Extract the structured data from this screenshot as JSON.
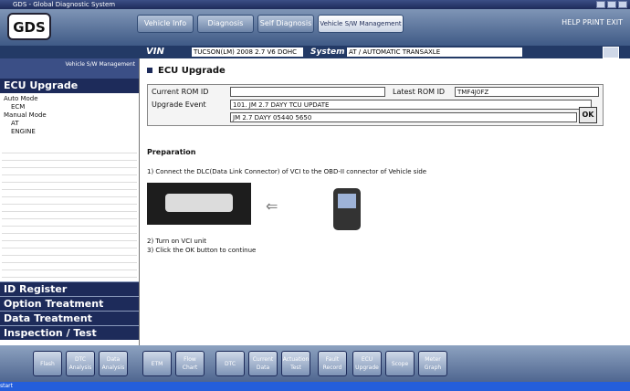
{
  "window": {
    "title": "GDS - Global Diagnostic System"
  },
  "app": {
    "logo": "GDS"
  },
  "top_tabs": [
    {
      "label": "Vehicle Info"
    },
    {
      "label": "Diagnosis"
    },
    {
      "label": "Self Diagnosis"
    },
    {
      "label": "Vehicle S/W Management"
    }
  ],
  "help": "HELP   PRINT   EXIT",
  "vinbar": {
    "vin_label": "VIN",
    "vin_value": "TUCSON(LM) 2008 2.7 V6 DOHC",
    "system_label": "System",
    "system_value": "AT / AUTOMATIC TRANSAXLE"
  },
  "sidebar": {
    "top_text": "Vehicle S/W Management",
    "header": "ECU Upgrade",
    "tree": [
      "Auto Mode",
      "ECM",
      "Manual Mode",
      "AT",
      "ENGINE"
    ],
    "menu": [
      "ID Register",
      "Option Treatment",
      "Data Treatment",
      "Inspection / Test"
    ]
  },
  "main": {
    "title": "ECU Upgrade",
    "current_rom_label": "Current ROM ID",
    "current_rom_value": "",
    "latest_rom_label": "Latest ROM ID",
    "latest_rom_value": "TMF4J0FZ",
    "upgrade_event_label": "Upgrade Event",
    "upgrade_event_value": "101. JM 2.7 DAYY TCU UPDATE",
    "select_value": "JM 2.7 DAYY 05440 5650",
    "ok": "OK",
    "preparation": "Preparation",
    "step1": "1) Connect the DLC(Data Link Connector) of VCI to the OBD-II connector of Vehicle side",
    "step2": "2) Turn on VCI unit",
    "step3": "3) Click the OK button to continue"
  },
  "bottom_buttons": [
    "Flash",
    "DTC Analysis",
    "Data Analysis",
    "ETM",
    "Flow Chart",
    "DTC",
    "Current Data",
    "Actuation Test",
    "Fault Record",
    "ECU Upgrade",
    "Scope",
    "Meter Graph"
  ],
  "taskbar": "start"
}
